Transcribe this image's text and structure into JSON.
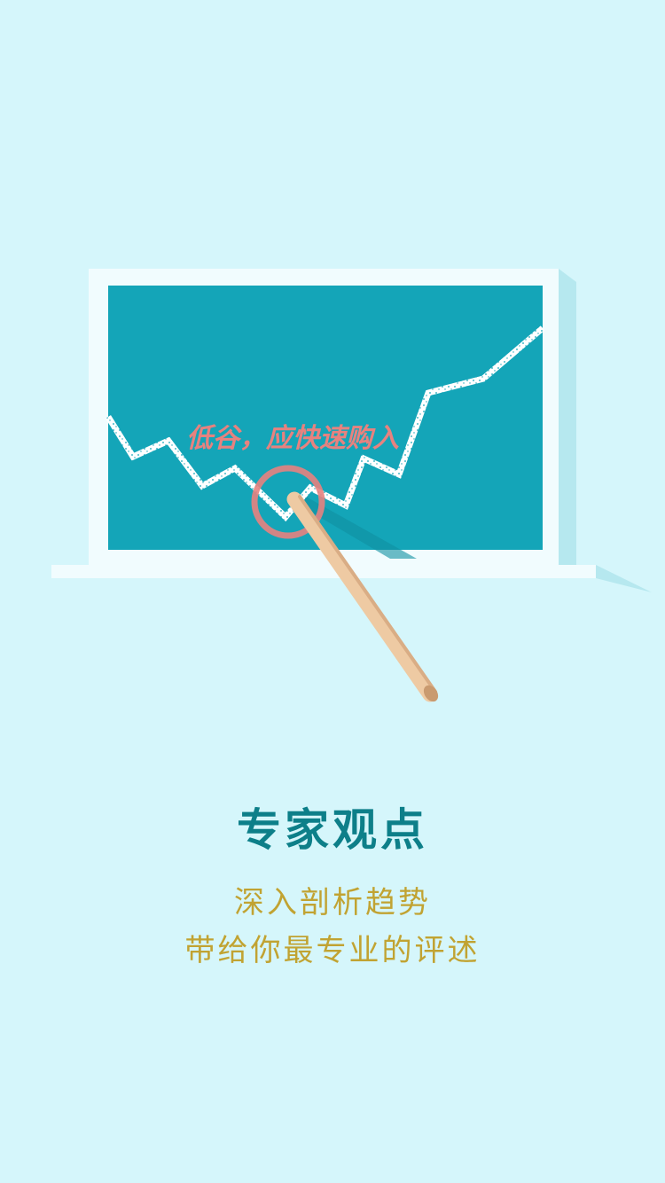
{
  "illustration": {
    "board_annotation": "低谷，应快速购入"
  },
  "heading": "专家观点",
  "subtitle_lines": [
    "深入剖析趋势",
    "带给你最专业的评述"
  ],
  "colors": {
    "background": "#d5f6fb",
    "board_frame": "#f1fcfe",
    "board_surface": "#14a5b8",
    "chalk_line": "#ffffff",
    "annotation": "#e7827f",
    "pointer": "#eecaa3",
    "heading": "#0d7f89",
    "subtitle": "#c1a332"
  }
}
